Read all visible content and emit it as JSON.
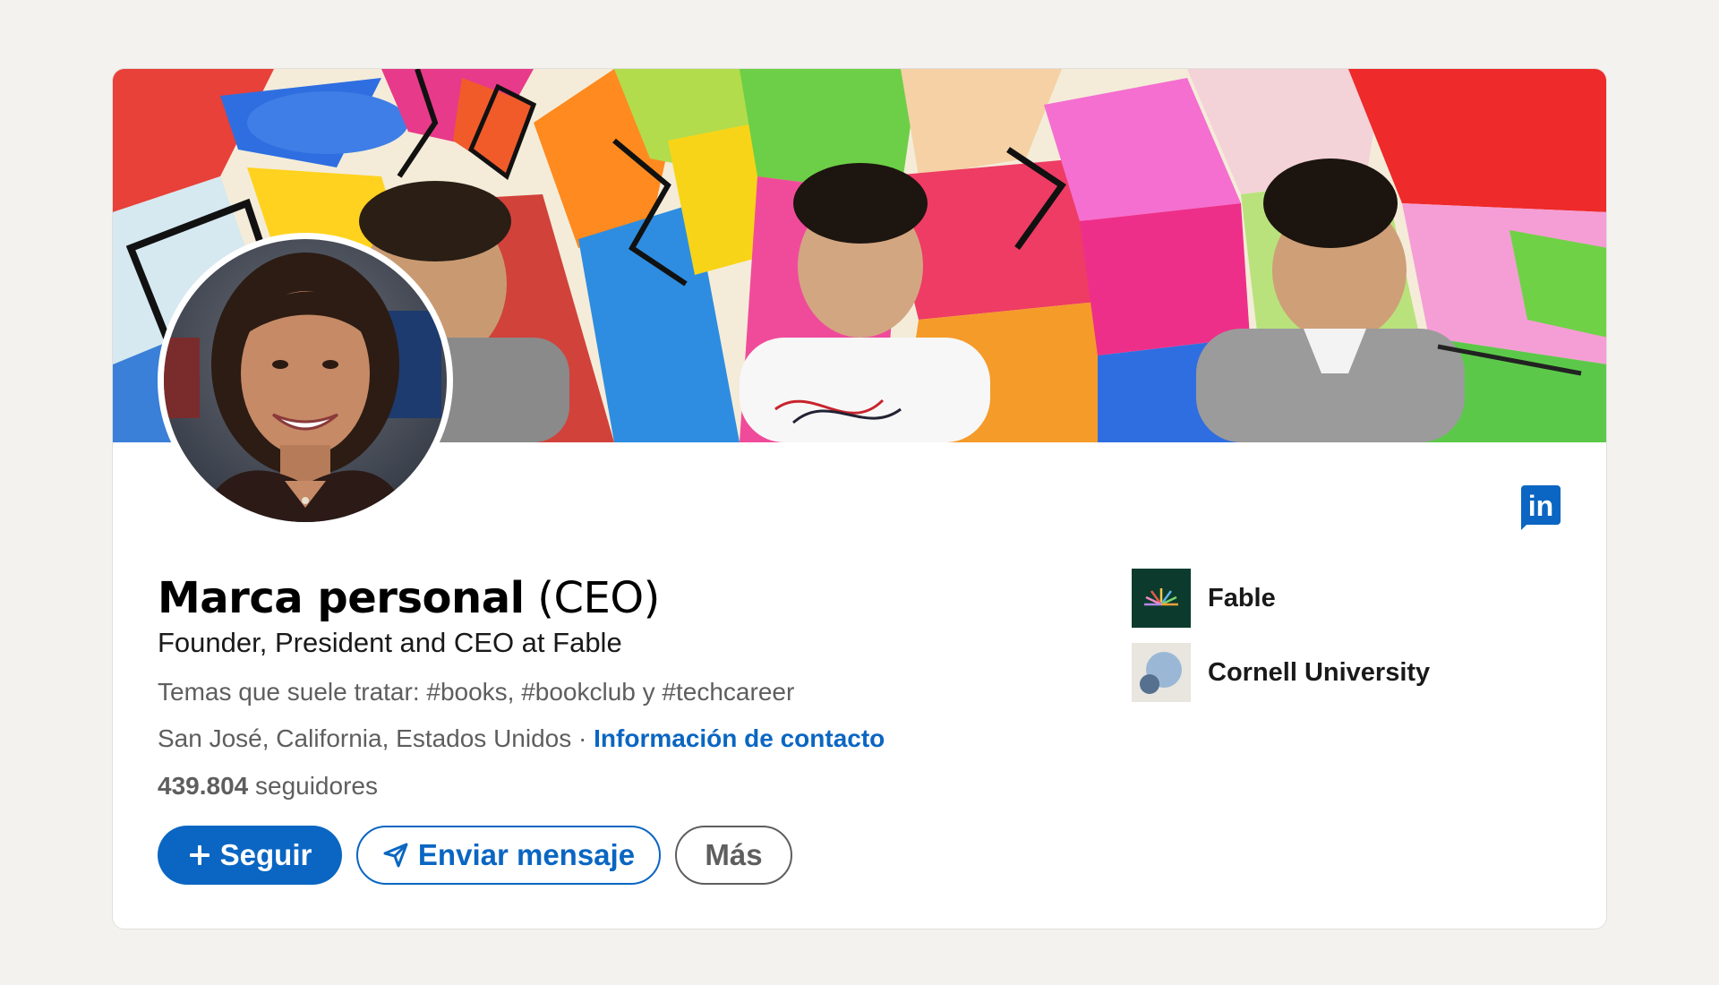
{
  "profile": {
    "name": "Marca personal",
    "role": "(CEO)",
    "headline": "Founder, President and CEO at Fable",
    "topics": "Temas que suele tratar: #books, #bookclub y #techcareer",
    "location": "San José, California, Estados Unidos",
    "separator": " · ",
    "contact_link": "Información de contacto",
    "followers_count": "439.804",
    "followers_label": " seguidores"
  },
  "actions": {
    "follow_label": "Seguir",
    "message_label": "Enviar mensaje",
    "more_label": "Más"
  },
  "organizations": [
    {
      "name": "Fable",
      "logo_icon": "fable-logo-icon"
    },
    {
      "name": "Cornell University",
      "logo_icon": "cornell-logo-icon"
    }
  ],
  "brand": {
    "linkedin_logo": "in",
    "accent_color": "#0a66c2"
  },
  "banner": {
    "description_icon": "colorful-mural-banner-image"
  }
}
